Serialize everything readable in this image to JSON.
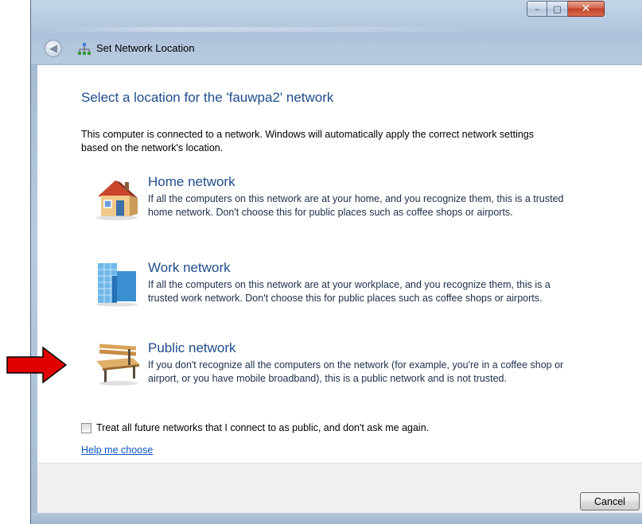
{
  "window": {
    "title": "Set Network Location",
    "back_icon": "back-arrow-icon",
    "network_icon": "network-icon",
    "caption": {
      "minimize": "–",
      "maximize": "□",
      "close": "✕"
    }
  },
  "main": {
    "heading": "Select a location for the 'fauwpa2' network",
    "intro": "This computer is connected to a network. Windows will automatically apply the correct network settings based on the network's location.",
    "options": [
      {
        "title": "Home network",
        "description": "If all the computers on this network are at your home, and you recognize them, this is a trusted home network.  Don't choose this for public places such as coffee shops or airports.",
        "icon": "house-icon"
      },
      {
        "title": "Work network",
        "description": "If all the computers on this network are at your workplace, and you recognize them, this is a trusted work network.  Don't choose this for public places such as coffee shops or airports.",
        "icon": "office-building-icon"
      },
      {
        "title": "Public network",
        "description": "If you don't recognize all the computers on the network (for example, you're in a coffee shop or airport, or you have mobile broadband), this is a public network and is not trusted.",
        "icon": "park-bench-icon"
      }
    ],
    "checkbox_label": "Treat all future networks that I connect to as public, and don't ask me again.",
    "checkbox_checked": false,
    "help_link": "Help me choose"
  },
  "footer": {
    "cancel_label": "Cancel"
  },
  "annotation": {
    "arrow_color": "#e00000",
    "points_to": "Public network"
  },
  "colors": {
    "heading": "#1e4d8c",
    "link": "#0b54c5"
  }
}
